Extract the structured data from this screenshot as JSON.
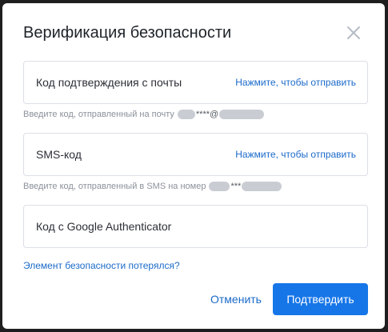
{
  "dialog": {
    "title": "Верификация безопасности"
  },
  "email_field": {
    "label": "Код подтверждения с почты",
    "action": "Нажмите, чтобы отправить",
    "hint_prefix": "Введите код, отправленный на почту",
    "hint_masked_middle": "****@"
  },
  "sms_field": {
    "label": "SMS-код",
    "action": "Нажмите, чтобы отправить",
    "hint_prefix": "Введите код, отправленный в SMS на номер",
    "hint_masked_middle": "***"
  },
  "google_field": {
    "label": "Код с Google Authenticator"
  },
  "lost_link": "Элемент безопасности потерялся?",
  "buttons": {
    "cancel": "Отменить",
    "confirm": "Подтвердить"
  },
  "colors": {
    "accent": "#1676e8",
    "link": "#1b6ac9",
    "title": "#1e2329",
    "hint": "#8b919b",
    "border": "#dcdfe4"
  },
  "icons": {
    "close": "close-icon"
  }
}
